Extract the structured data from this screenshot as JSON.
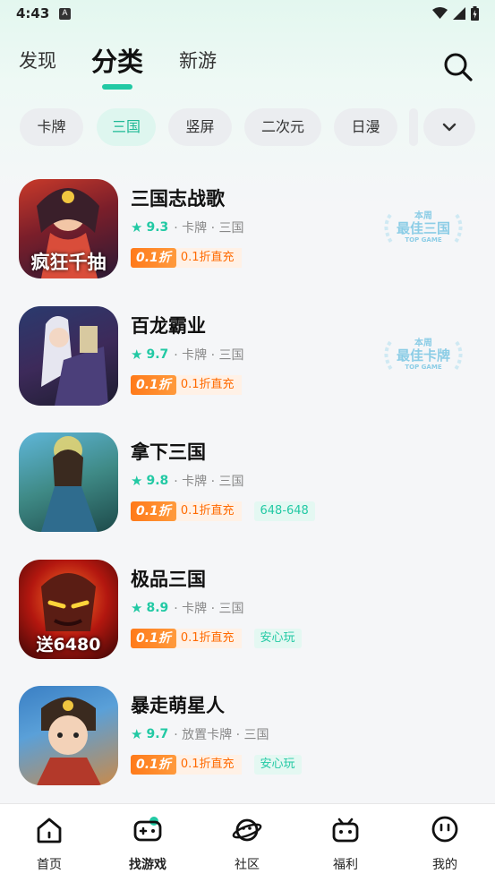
{
  "status_bar": {
    "time": "4:43",
    "a_label": "A"
  },
  "tabs": [
    {
      "label": "发现"
    },
    {
      "label": "分类"
    },
    {
      "label": "新游"
    }
  ],
  "chips": [
    "卡牌",
    "三国",
    "竖屏",
    "二次元",
    "日漫"
  ],
  "games": [
    {
      "name": "三国志战歌",
      "score": "9.3",
      "meta": "· 卡牌 · 三国",
      "discount": "0.1折",
      "discount_label": "0.1折直充",
      "extra": "",
      "award": {
        "top": "本周",
        "main": "最佳三国",
        "sub": "TOP GAME"
      },
      "icon_text": "疯狂千抽"
    },
    {
      "name": "百龙霸业",
      "score": "9.7",
      "meta": "· 卡牌 · 三国",
      "discount": "0.1折",
      "discount_label": "0.1折直充",
      "extra": "",
      "award": {
        "top": "本周",
        "main": "最佳卡牌",
        "sub": "TOP GAME"
      },
      "icon_text": ""
    },
    {
      "name": "拿下三国",
      "score": "9.8",
      "meta": "· 卡牌 · 三国",
      "discount": "0.1折",
      "discount_label": "0.1折直充",
      "extra": "648-648",
      "icon_text": ""
    },
    {
      "name": "极品三国",
      "score": "8.9",
      "meta": "· 卡牌 · 三国",
      "discount": "0.1折",
      "discount_label": "0.1折直充",
      "extra": "安心玩",
      "icon_text": "送6480"
    },
    {
      "name": "暴走萌星人",
      "score": "9.7",
      "meta": "· 放置卡牌 · 三国",
      "discount": "0.1折",
      "discount_label": "0.1折直充",
      "extra": "安心玩",
      "icon_text": ""
    }
  ],
  "bottom_nav": [
    {
      "label": "首页",
      "icon": "home-icon"
    },
    {
      "label": "找游戏",
      "icon": "gamepad-icon"
    },
    {
      "label": "社区",
      "icon": "planet-icon"
    },
    {
      "label": "福利",
      "icon": "gift-tv-icon"
    },
    {
      "label": "我的",
      "icon": "face-icon"
    }
  ],
  "colors": {
    "accent": "#22c9a4",
    "discount": "#ff7a1a"
  }
}
